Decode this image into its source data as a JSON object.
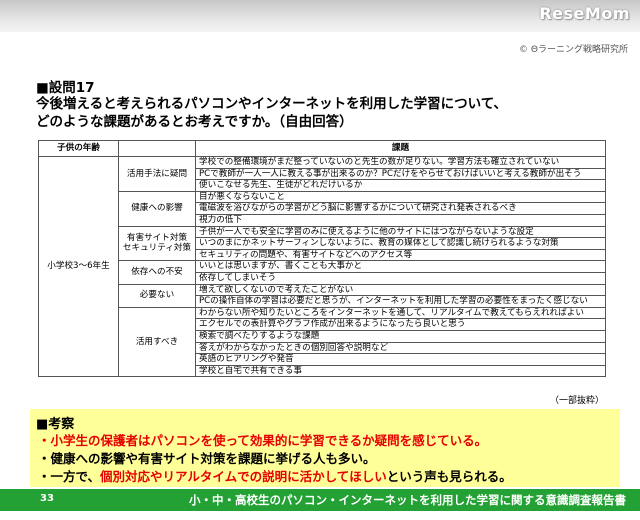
{
  "site_logo": "ReseMom",
  "copyright": "© Θラーニング戦略研究所",
  "question": {
    "number": "■設問17",
    "line1": "今後増えると考えられるパソコンやインターネットを利用した学習について、",
    "line2": "どのような課題があるとお考えですか。（自由回答）"
  },
  "table": {
    "headers": [
      "子供の年齢",
      "",
      "課題"
    ],
    "age_group": "小学校3～6年生",
    "groups": [
      {
        "category": [
          "活用手法に疑問"
        ],
        "items": [
          "学校での整備環境がまだ整っていないのと先生の数が足りない。学習方法も確立されていない",
          "PCで教師が一人一人に教える事が出来るのか？PCだけをやらせておけばいいと考える教師が出そう",
          "使いこなせる先生、生徒がどれだけいるか"
        ]
      },
      {
        "category": [
          "健康への影響"
        ],
        "items": [
          "目が悪くならないこと",
          "電磁波を浴びながらの学習がどう脳に影響するかについて研究され発表されるべき",
          "視力の低下"
        ]
      },
      {
        "category": [
          "有害サイト対策",
          "セキュリティ対策"
        ],
        "items": [
          "子供が一人でも安全に学習のみに使えるように他のサイトにはつながらないような設定",
          "いつのまにかネットサーフィンしないように、教育の媒体として認識し続けられるような対策",
          "セキュリティの問題や、有害サイトなどへのアクセス等"
        ]
      },
      {
        "category": [
          "依存への不安"
        ],
        "items": [
          "いいとは思いますが、書くことも大事かと",
          "依存してしまいそう"
        ]
      },
      {
        "category": [
          "必要ない"
        ],
        "items": [
          "増えて欲しくないので考えたことがない",
          "PCの操作自体の学習は必要だと思うが、インターネットを利用した学習の必要性をまったく感じない"
        ]
      },
      {
        "category": [
          "活用すべき"
        ],
        "items": [
          "わからない所や知りたいところをインターネットを通して、リアルタイムで教えてもらえれればよい",
          "エクセルでの表計算やグラフ作成が出来るようになったら良いと思う",
          "検索で調べたりするような課題",
          "答えがわからなかったときの個別回答や説明など",
          "英語のヒアリングや発音",
          "学校と自宅で共有できる事"
        ]
      }
    ]
  },
  "excerpt_note": "（一部抜粋）",
  "consideration": {
    "title": "■考察",
    "line1_red": "・小学生の保護者はパソコンを使って効果的に学習できるか疑問を感じている。",
    "line2": "・健康への影響や有害サイト対策を課題に挙げる人も多い。",
    "line3_pre": "・一方で、",
    "line3_red": "個別対応やリアルタイムでの説明に活かしてほしい",
    "line3_post": "という声も見られる。"
  },
  "footer": {
    "page_number": "33",
    "report_title": "小・中・高校生のパソコン・インターネットを利用した学習に関する意識調査報告書"
  },
  "colors": {
    "footer_bg": "#24a134",
    "consideration_bg": "#ffff99",
    "highlight_red": "#e60000"
  }
}
